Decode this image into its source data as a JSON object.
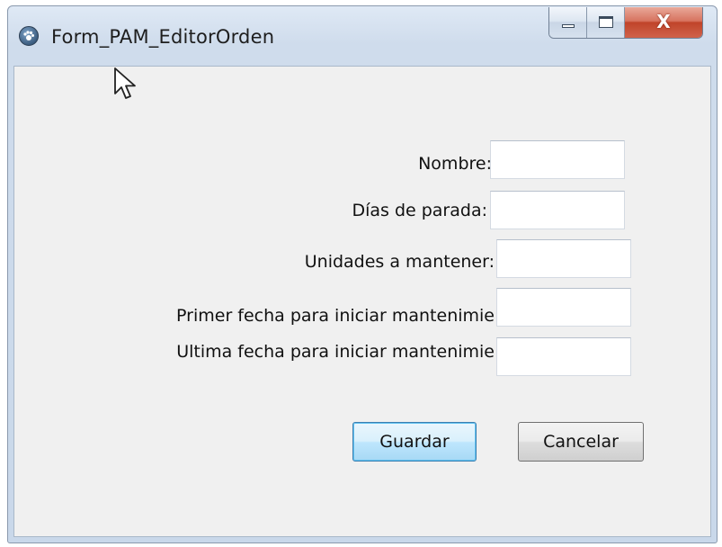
{
  "window": {
    "title": "Form_PAM_EditorOrden",
    "icon": "paw-icon",
    "controls": {
      "minimize": "minimize-icon",
      "maximize": "maximize-icon",
      "close_glyph": "X"
    }
  },
  "form": {
    "fields": [
      {
        "label": "Nombre:",
        "value": ""
      },
      {
        "label": "Días de parada:",
        "value": ""
      },
      {
        "label": "Unidades a mantener:",
        "value": ""
      },
      {
        "label": "Primer fecha para iniciar mantenimie",
        "value": ""
      },
      {
        "label": "Ultima fecha para iniciar mantenimie",
        "value": ""
      }
    ],
    "buttons": {
      "save_label": "Guardar",
      "cancel_label": "Cancelar"
    }
  },
  "colors": {
    "default_button_border": "#3c7fb1",
    "close_button": "#c0442a",
    "client_background": "#f0f0f0"
  }
}
